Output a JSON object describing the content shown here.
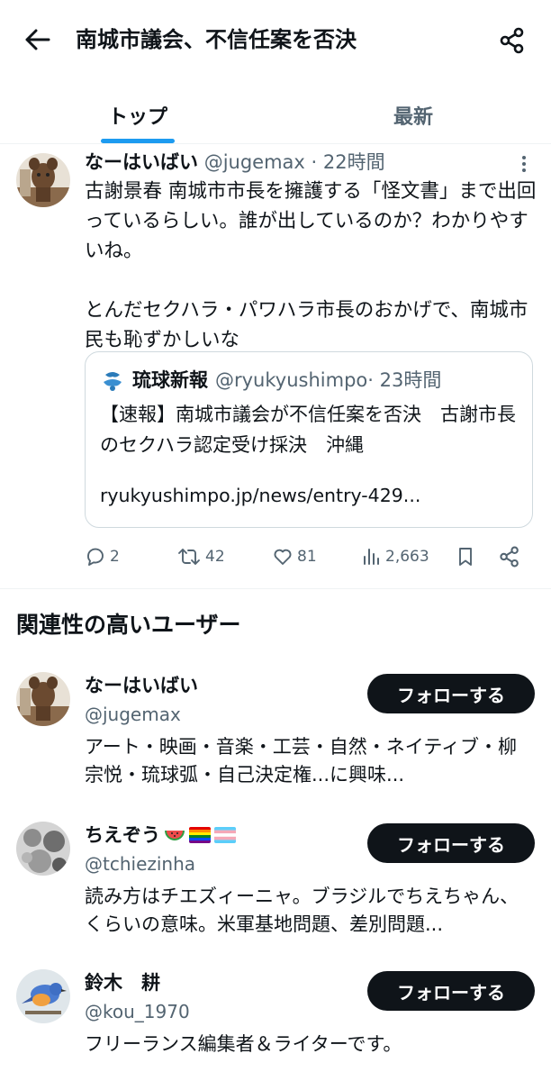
{
  "header": {
    "title": "南城市議会、不信任案を否決",
    "back_icon": "arrow-left-icon",
    "share_icon": "share-icon"
  },
  "tabs": [
    {
      "label": "トップ",
      "active": true
    },
    {
      "label": "最新",
      "active": false
    }
  ],
  "tweet": {
    "display_name": "なーはいばい",
    "handle": "@jugemax",
    "time": "· 22時間",
    "text": "古謝景春 南城市市長を擁護する「怪文書」まで出回っているらしい。誰が出しているのか？わかりやすいね。\n\nとんだセクハラ・パワハラ市長のおかげで、南城市民も恥ずかしいな",
    "quote": {
      "display_name": "琉球新報",
      "handle": "@ryukyushimpo",
      "time": "· 23時間",
      "text": "【速報】南城市議会が不信任案を否決　古謝市長のセクハラ認定受け採決　沖縄",
      "link": "ryukyushimpo.jp/news/entry-429..."
    },
    "actions": {
      "replies": "2",
      "retweets": "42",
      "likes": "81",
      "views": "2,663"
    }
  },
  "relevant_users": {
    "heading": "関連性の高いユーザー",
    "follow_label": "フォローする",
    "users": [
      {
        "display_name": "なーはいばい",
        "handle": "@jugemax",
        "bio": "アート・映画・音楽・工芸・自然・ネイティブ・柳宗悦・琉球弧・自己決定権...に興味..."
      },
      {
        "display_name": "ちえぞう",
        "handle": "@tchiezinha",
        "bio": "読み方はチエズィーニャ。ブラジルでちえちゃん、くらいの意味。米軍基地問題、差別問題..."
      },
      {
        "display_name": "鈴木　耕",
        "handle": "@kou_1970",
        "bio": "フリーランス編集者＆ライターです。"
      }
    ]
  },
  "colors": {
    "accent": "#1d9bf0",
    "text": "#0f1419",
    "muted": "#536471",
    "border": "#cfd9de"
  }
}
